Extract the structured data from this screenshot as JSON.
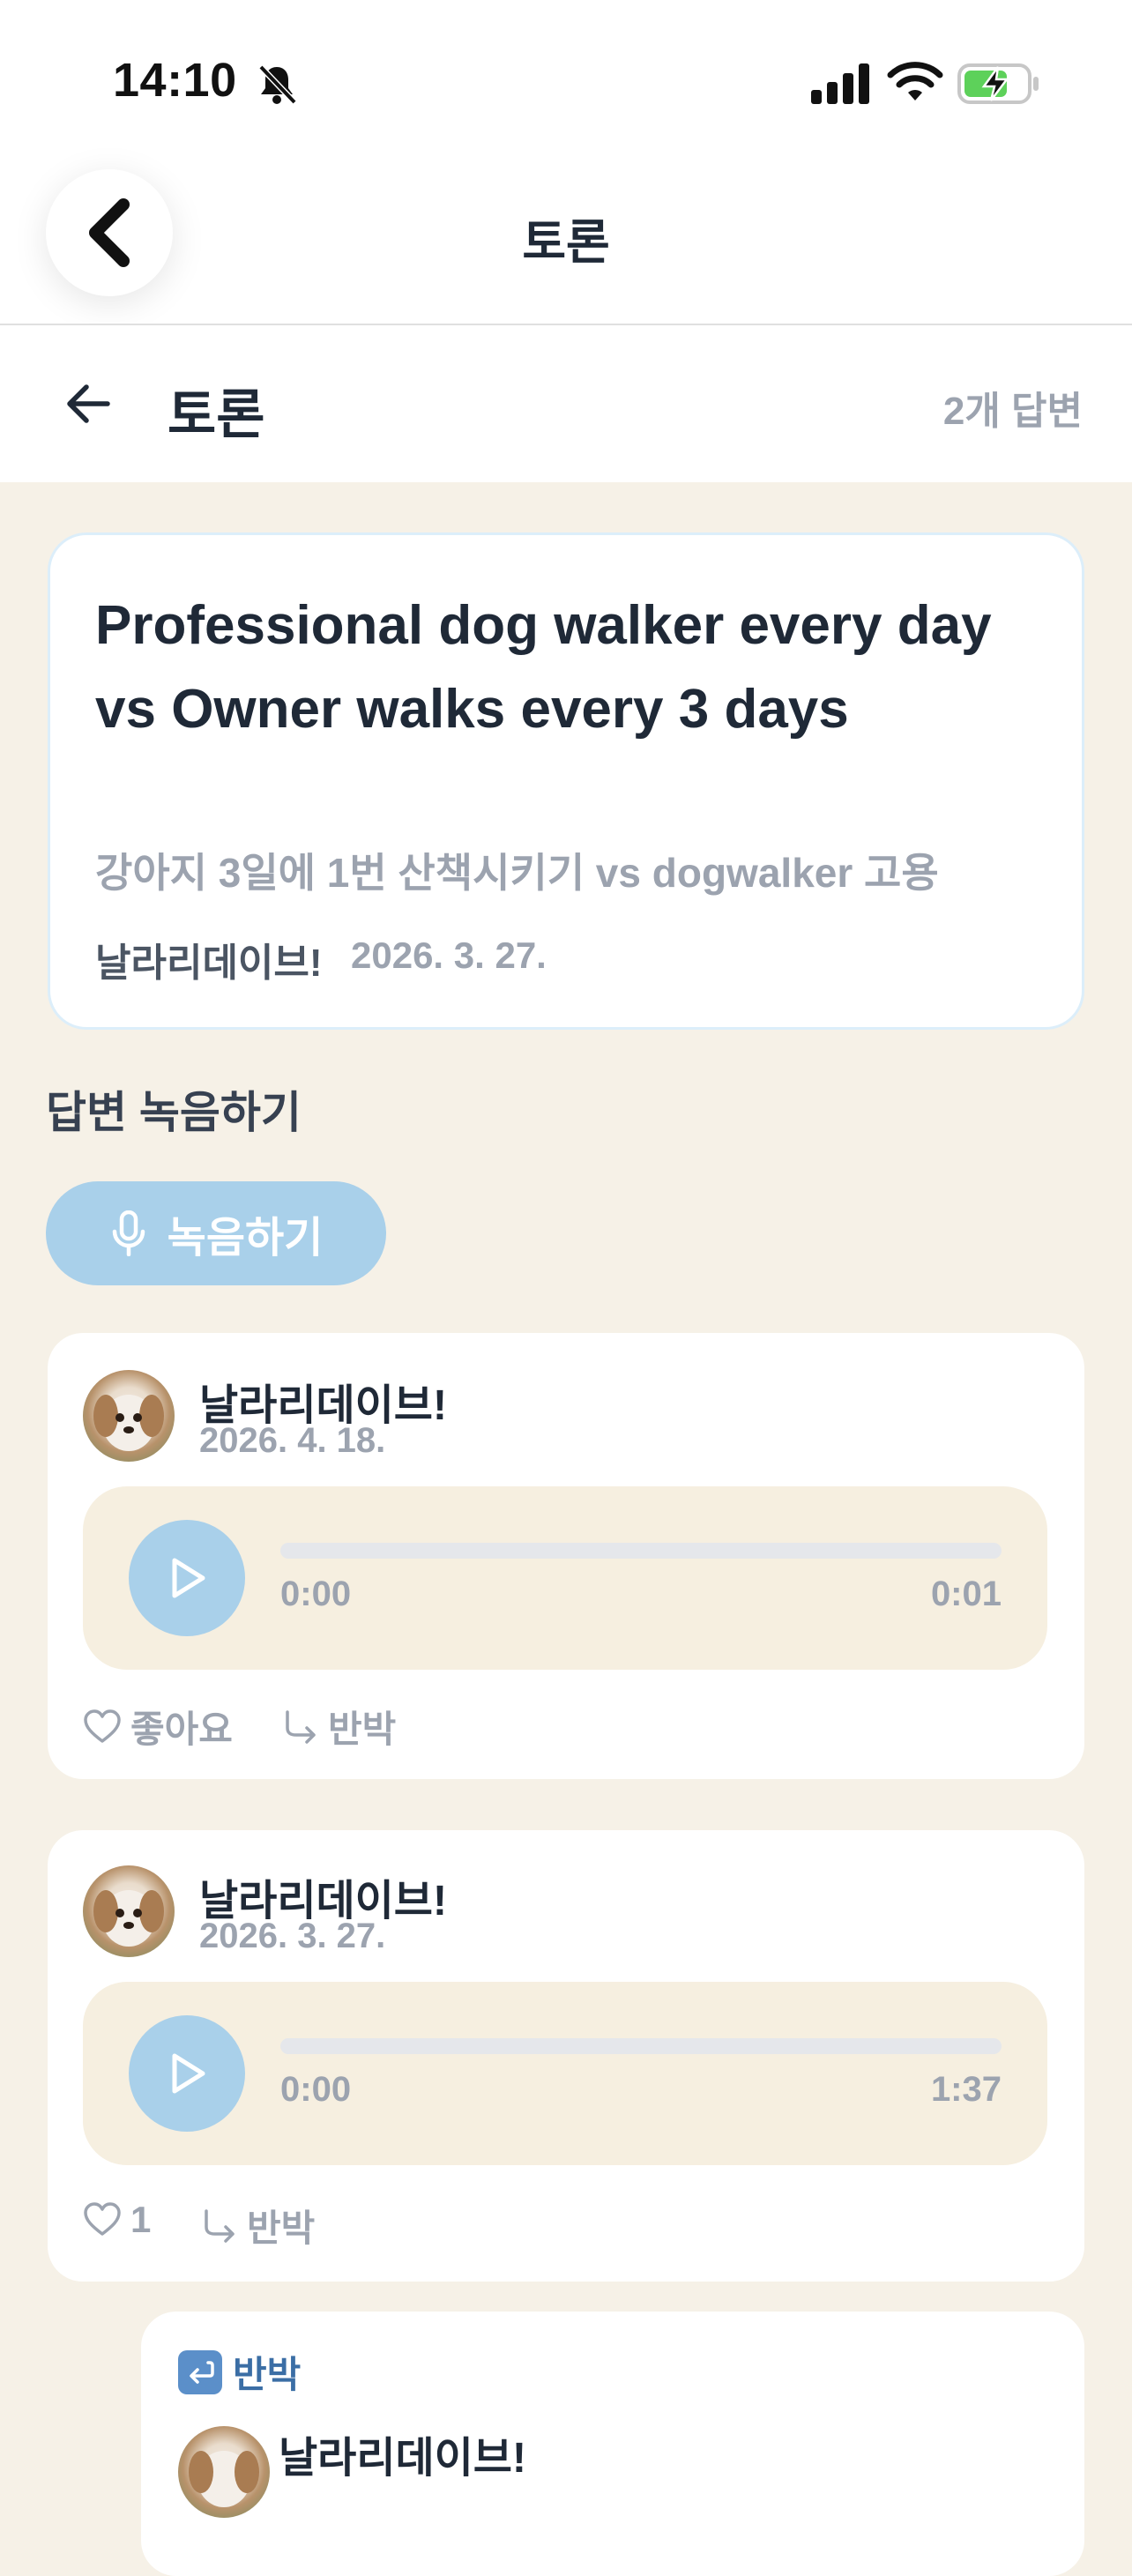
{
  "status_bar": {
    "time": "14:10",
    "icons": [
      "bell-slash-icon",
      "signal-icon",
      "wifi-icon",
      "battery-charging-icon"
    ],
    "battery_color": "#5dd15a"
  },
  "nav": {
    "title": "토론",
    "back_icon": "chevron-left-icon"
  },
  "subheader": {
    "title": "토론",
    "answers_count": "2개 답변",
    "back_icon": "arrow-left-icon"
  },
  "topic": {
    "title": "Professional dog walker every day vs Owner walks every 3 days",
    "subtitle": "강아지 3일에 1번 산책시키기 vs dogwalker 고용",
    "author": "날라리데이브!",
    "date": "2026. 3. 27."
  },
  "record": {
    "section_label": "답변 녹음하기",
    "button_label": "녹음하기",
    "icon": "microphone-icon"
  },
  "answers": [
    {
      "author": "날라리데이브!",
      "date": "2026. 4. 18.",
      "time_current": "0:00",
      "time_total": "0:01",
      "progress": 0,
      "like_label": "좋아요",
      "reply_label": "반박"
    },
    {
      "author": "날라리데이브!",
      "date": "2026. 3. 27.",
      "time_current": "0:00",
      "time_total": "1:37",
      "progress": 0,
      "like_label": "1",
      "reply_label": "반박"
    }
  ],
  "rebuttal": {
    "tag_label": "반박",
    "author": "날라리데이브!"
  },
  "colors": {
    "background": "#f6f1e7",
    "accent": "#a9d0ea",
    "player_bg": "#f6efe0",
    "muted_text": "#9ca3af"
  }
}
